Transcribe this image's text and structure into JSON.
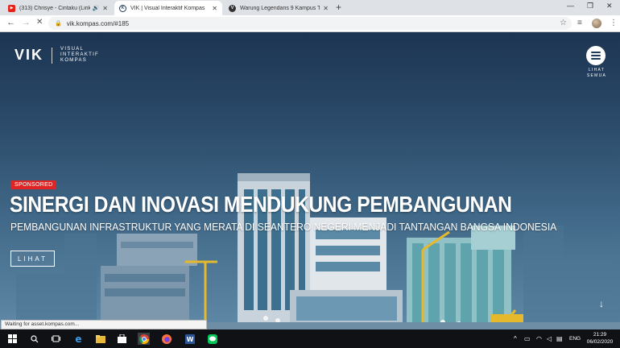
{
  "browser": {
    "tabs": [
      {
        "title": "(313) Chrisye - Cintaku (Lirik",
        "favicon": "youtube-favicon",
        "favicon_color": "#e62117",
        "audio": true,
        "active": false
      },
      {
        "title": "VIK | Visual Interaktif Kompas",
        "favicon": "kompas-favicon",
        "favicon_color": "#1d3a58",
        "active": true
      },
      {
        "title": "Warung Legendaris 9 Kampus Te",
        "favicon": "vik-favicon",
        "favicon_color": "#333333",
        "active": false
      }
    ],
    "new_tab": "+",
    "url": "vik.kompas.com/#185"
  },
  "page": {
    "logo": {
      "brand": "VIK",
      "line1": "VISUAL",
      "line2": "INTERAKTIF",
      "line3": "KOMPAS"
    },
    "menu": {
      "line1": "LIHAT",
      "line2": "SEMUA"
    },
    "badge": "SPONSORED",
    "headline": "SINERGI DAN INOVASI MENDUKUNG PEMBANGUNAN",
    "subheadline": "PEMBANGUNAN INFRASTRUKTUR YANG MERATA DI SEANTERO NEGERI MENJADI TANTANGAN BANGSA INDONESIA",
    "cta": "LIHAT",
    "colors": {
      "badge": "#e02424",
      "accent": "#1d3a58"
    }
  },
  "status_text": "Waiting for asset.kompas.com...",
  "taskbar": {
    "lang": "ENG",
    "time": "21:29",
    "date": "06/02/2020"
  }
}
